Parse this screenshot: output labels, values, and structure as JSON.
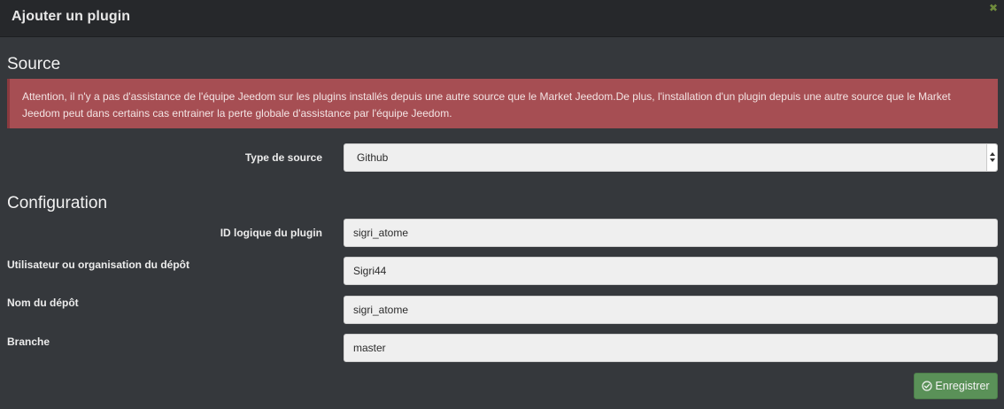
{
  "modal": {
    "title": "Ajouter un plugin",
    "close_icon": "close-icon"
  },
  "source_section": {
    "heading": "Source",
    "alert_text": "Attention, il n'y a pas d'assistance de l'équipe Jeedom sur les plugins installés depuis une autre source que le Market Jeedom.De plus, l'installation d'un plugin depuis une autre source que le Market Jeedom peut dans certains cas entrainer la perte globale d'assistance par l'équipe Jeedom.",
    "type_label": "Type de source",
    "type_value": "Github"
  },
  "config_section": {
    "heading": "Configuration",
    "fields": [
      {
        "label": "ID logique du plugin",
        "value": "sigri_atome"
      },
      {
        "label": "Utilisateur ou organisation du dépôt",
        "value": "Sigri44"
      },
      {
        "label": "Nom du dépôt",
        "value": "sigri_atome"
      },
      {
        "label": "Branche",
        "value": "master"
      }
    ]
  },
  "actions": {
    "save_label": "Enregistrer",
    "save_icon": "check-circle-icon"
  },
  "colors": {
    "alert_bg": "#a64e53",
    "save_bg": "#5a9158",
    "titlebar_bg": "#26282b",
    "body_bg": "#35383c"
  }
}
